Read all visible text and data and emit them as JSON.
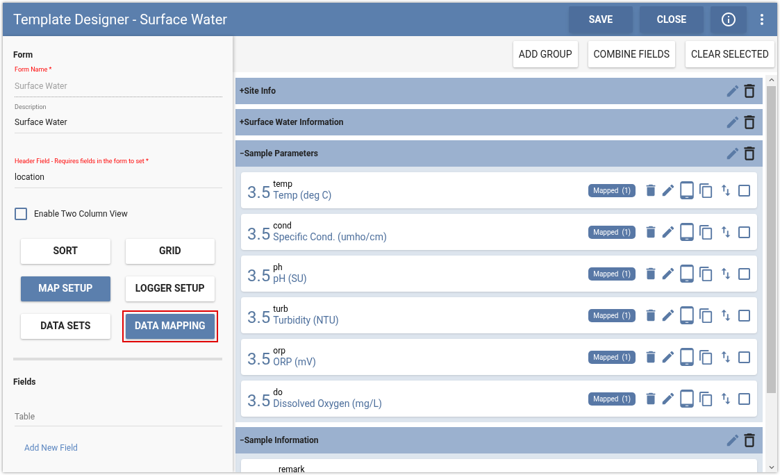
{
  "window": {
    "title": "Template Designer - Surface Water",
    "buttons": [
      "SAVE",
      "CLOSE"
    ]
  },
  "form": {
    "heading": "Form",
    "form_name": {
      "label": "Form Name *",
      "value": "Surface Water",
      "disabled": true
    },
    "description": {
      "label": "Description",
      "value": "Surface Water"
    },
    "header_field": {
      "label": "Header Field - Requires fields in the form to set *",
      "value": "location"
    },
    "two_column": {
      "label": "Enable Two Column View",
      "checked": false
    },
    "buttons": [
      {
        "label": "SORT",
        "primary": false,
        "highlighted": false
      },
      {
        "label": "GRID",
        "primary": false,
        "highlighted": false
      },
      {
        "label": "MAP SETUP",
        "primary": true,
        "highlighted": false
      },
      {
        "label": "LOGGER SETUP",
        "primary": false,
        "highlighted": false
      },
      {
        "label": "DATA SETS",
        "primary": false,
        "highlighted": false
      },
      {
        "label": "DATA MAPPING",
        "primary": true,
        "highlighted": true
      }
    ]
  },
  "fields": {
    "heading": "Fields",
    "table_value": "Table",
    "add_link": "Add New Field"
  },
  "toolbar": [
    "ADD GROUP",
    "COMBINE FIELDS",
    "CLEAR SELECTED"
  ],
  "groups": [
    {
      "sign": "+",
      "title": "Site Info",
      "expanded": false
    },
    {
      "sign": "+",
      "title": "Surface Water Information",
      "expanded": false
    },
    {
      "sign": "−",
      "title": "Sample Parameters",
      "expanded": true,
      "items": [
        {
          "number": "3.5",
          "code": "temp",
          "label": "Temp (deg C)",
          "badge": "Mapped",
          "count": "(1)",
          "checked": false
        },
        {
          "number": "3.5",
          "code": "cond",
          "label": "Specific Cond. (umho/cm)",
          "badge": "Mapped",
          "count": "(1)",
          "checked": false
        },
        {
          "number": "3.5",
          "code": "ph",
          "label": "pH (SU)",
          "badge": "Mapped",
          "count": "(1)",
          "checked": false
        },
        {
          "number": "3.5",
          "code": "turb",
          "label": "Turbidity (NTU)",
          "badge": "Mapped",
          "count": "(1)",
          "checked": false
        },
        {
          "number": "3.5",
          "code": "orp",
          "label": "ORP (mV)",
          "badge": "Mapped",
          "count": "(1)",
          "checked": false
        },
        {
          "number": "3.5",
          "code": "do",
          "label": "Dissolved Oxygen (mg/L)",
          "badge": "Mapped",
          "count": "(1)",
          "checked": false
        }
      ]
    },
    {
      "sign": "−",
      "title": "Sample Information",
      "expanded": true,
      "items": [
        {
          "code": "remark"
        }
      ]
    }
  ]
}
